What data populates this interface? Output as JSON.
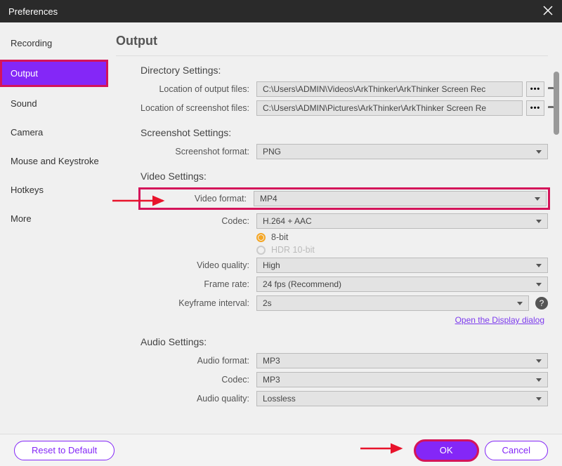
{
  "window": {
    "title": "Preferences"
  },
  "sidebar": {
    "items": [
      {
        "label": "Recording"
      },
      {
        "label": "Output"
      },
      {
        "label": "Sound"
      },
      {
        "label": "Camera"
      },
      {
        "label": "Mouse and Keystroke"
      },
      {
        "label": "Hotkeys"
      },
      {
        "label": "More"
      }
    ]
  },
  "page": {
    "title": "Output",
    "directory": {
      "title": "Directory Settings:",
      "output_label": "Location of output files:",
      "output_value": "C:\\Users\\ADMIN\\Videos\\ArkThinker\\ArkThinker Screen Rec",
      "screenshot_label": "Location of screenshot files:",
      "screenshot_value": "C:\\Users\\ADMIN\\Pictures\\ArkThinker\\ArkThinker Screen Re"
    },
    "screenshot": {
      "title": "Screenshot Settings:",
      "format_label": "Screenshot format:",
      "format_value": "PNG"
    },
    "video": {
      "title": "Video Settings:",
      "format_label": "Video format:",
      "format_value": "MP4",
      "codec_label": "Codec:",
      "codec_value": "H.264 + AAC",
      "bit8": "8-bit",
      "hdr": "HDR 10-bit",
      "quality_label": "Video quality:",
      "quality_value": "High",
      "framerate_label": "Frame rate:",
      "framerate_value": "24 fps (Recommend)",
      "keyframe_label": "Keyframe interval:",
      "keyframe_value": "2s",
      "display_link": "Open the Display dialog"
    },
    "audio": {
      "title": "Audio Settings:",
      "format_label": "Audio format:",
      "format_value": "MP3",
      "codec_label": "Codec:",
      "codec_value": "MP3",
      "quality_label": "Audio quality:",
      "quality_value": "Lossless"
    }
  },
  "footer": {
    "reset": "Reset to Default",
    "ok": "OK",
    "cancel": "Cancel"
  }
}
